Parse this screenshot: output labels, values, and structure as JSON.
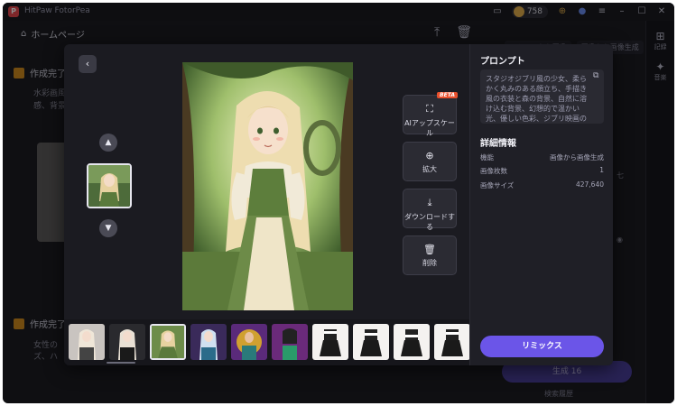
{
  "app": {
    "title": "HitPaw FotorPea",
    "credits": "758",
    "home_label": "ホームページ",
    "mode_tabs": [
      "テキストから画像",
      "画像から画像生成"
    ],
    "rail_items": [
      "記録",
      "音楽"
    ],
    "sections": [
      {
        "title": "作成完了",
        "text1": "水彩画風",
        "text2": "感、背景"
      },
      {
        "title": "作成完了",
        "text1": "女性の",
        "text2": "ズ、ハ"
      }
    ],
    "generate_label": "生成",
    "generate_cost": "16",
    "footer_label": "検索履歴"
  },
  "modal": {
    "back_icon": "chevron-left-icon",
    "actions": [
      {
        "label": "AIアップスケール",
        "icon": "upscale-icon",
        "badge": "BETA"
      },
      {
        "label": "拡大",
        "icon": "zoom-in-icon"
      },
      {
        "label": "ダウンロードする",
        "icon": "download-icon"
      },
      {
        "label": "削除",
        "icon": "trash-icon"
      }
    ],
    "panel": {
      "prompt_title": "プロンプト",
      "prompt_text": "スタジオジブリ風の少女、柔らかく丸みのある顔立ち、手描き風の衣装と森の背景、自然に溶け込む背景、幻想的で温かい光、優しい色彩、ジブリ映画のキャラクターと同じテイストで、ジブリの世界観を再現",
      "details_title": "詳細情報",
      "details": [
        {
          "label": "機能",
          "value": "画像から画像生成"
        },
        {
          "label": "画像枚数",
          "value": "1"
        },
        {
          "label": "画像サイズ",
          "value": "427,640"
        }
      ],
      "remix_label": "リミックス"
    }
  },
  "colors": {
    "accent": "#6b55e8",
    "beta": "#e8502d",
    "modal_bg": "#1b1b21"
  }
}
